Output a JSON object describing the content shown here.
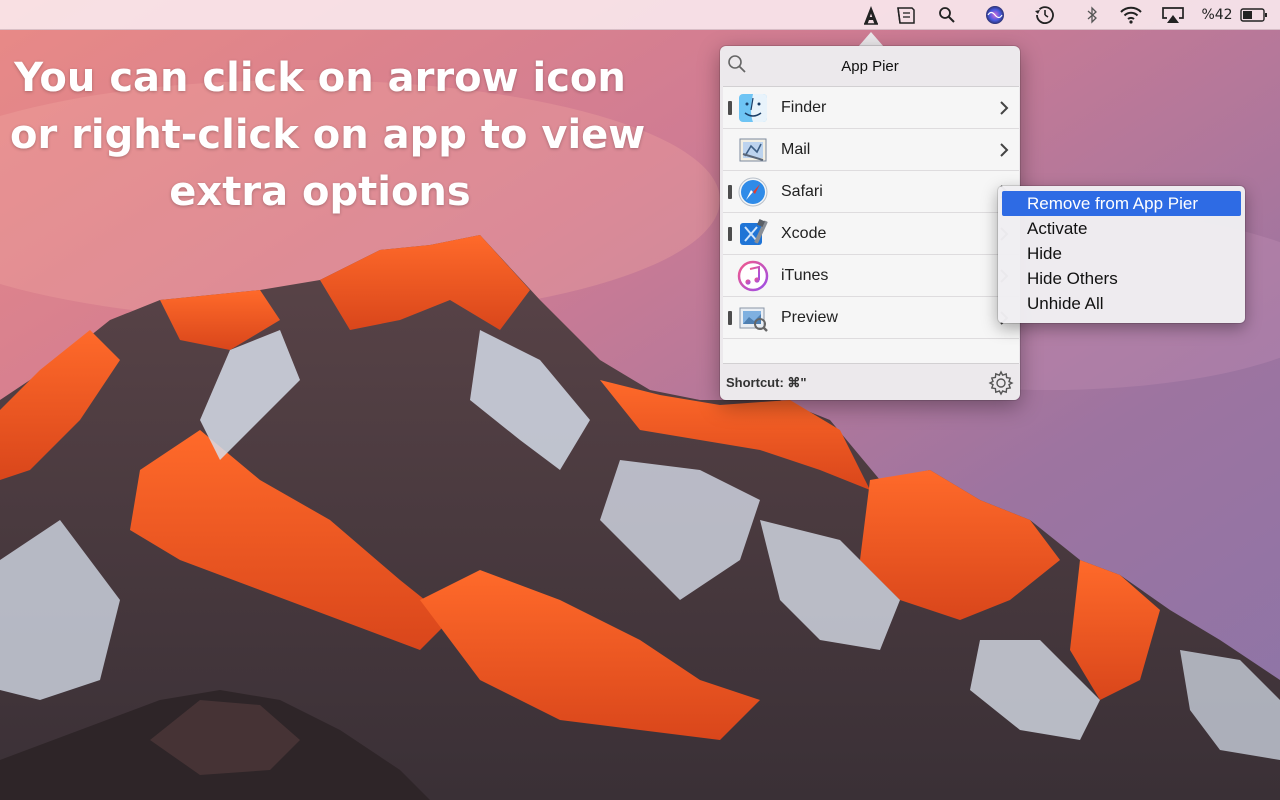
{
  "menubar": {
    "battery_text": "%42",
    "icons": [
      "app-pier-icon",
      "app-notes-icon",
      "spotlight-search-icon",
      "siri-icon",
      "time-machine-icon",
      "bluetooth-icon",
      "wifi-icon",
      "airplay-icon",
      "battery-icon"
    ]
  },
  "caption": {
    "lines": [
      "You can click on arrow icon",
      "or right-click on app to view",
      "extra options"
    ]
  },
  "popover": {
    "title": "App Pier",
    "apps": [
      {
        "name": "Finder",
        "running": true,
        "icon": "finder-icon"
      },
      {
        "name": "Mail",
        "running": false,
        "icon": "mail-icon"
      },
      {
        "name": "Safari",
        "running": true,
        "icon": "safari-icon"
      },
      {
        "name": "Xcode",
        "running": true,
        "icon": "xcode-icon"
      },
      {
        "name": "iTunes",
        "running": false,
        "icon": "itunes-icon"
      },
      {
        "name": "Preview",
        "running": true,
        "icon": "preview-icon"
      }
    ],
    "shortcut": "Shortcut: ⌘\""
  },
  "context_menu": {
    "items": [
      {
        "label": "Remove from App Pier",
        "highlighted": true
      },
      {
        "label": "Activate",
        "highlighted": false
      },
      {
        "label": "Hide",
        "highlighted": false
      },
      {
        "label": "Hide Others",
        "highlighted": false
      },
      {
        "label": "Unhide All",
        "highlighted": false
      }
    ]
  },
  "colors": {
    "highlight": "#2e6be4",
    "menubar": "#faecf0"
  }
}
